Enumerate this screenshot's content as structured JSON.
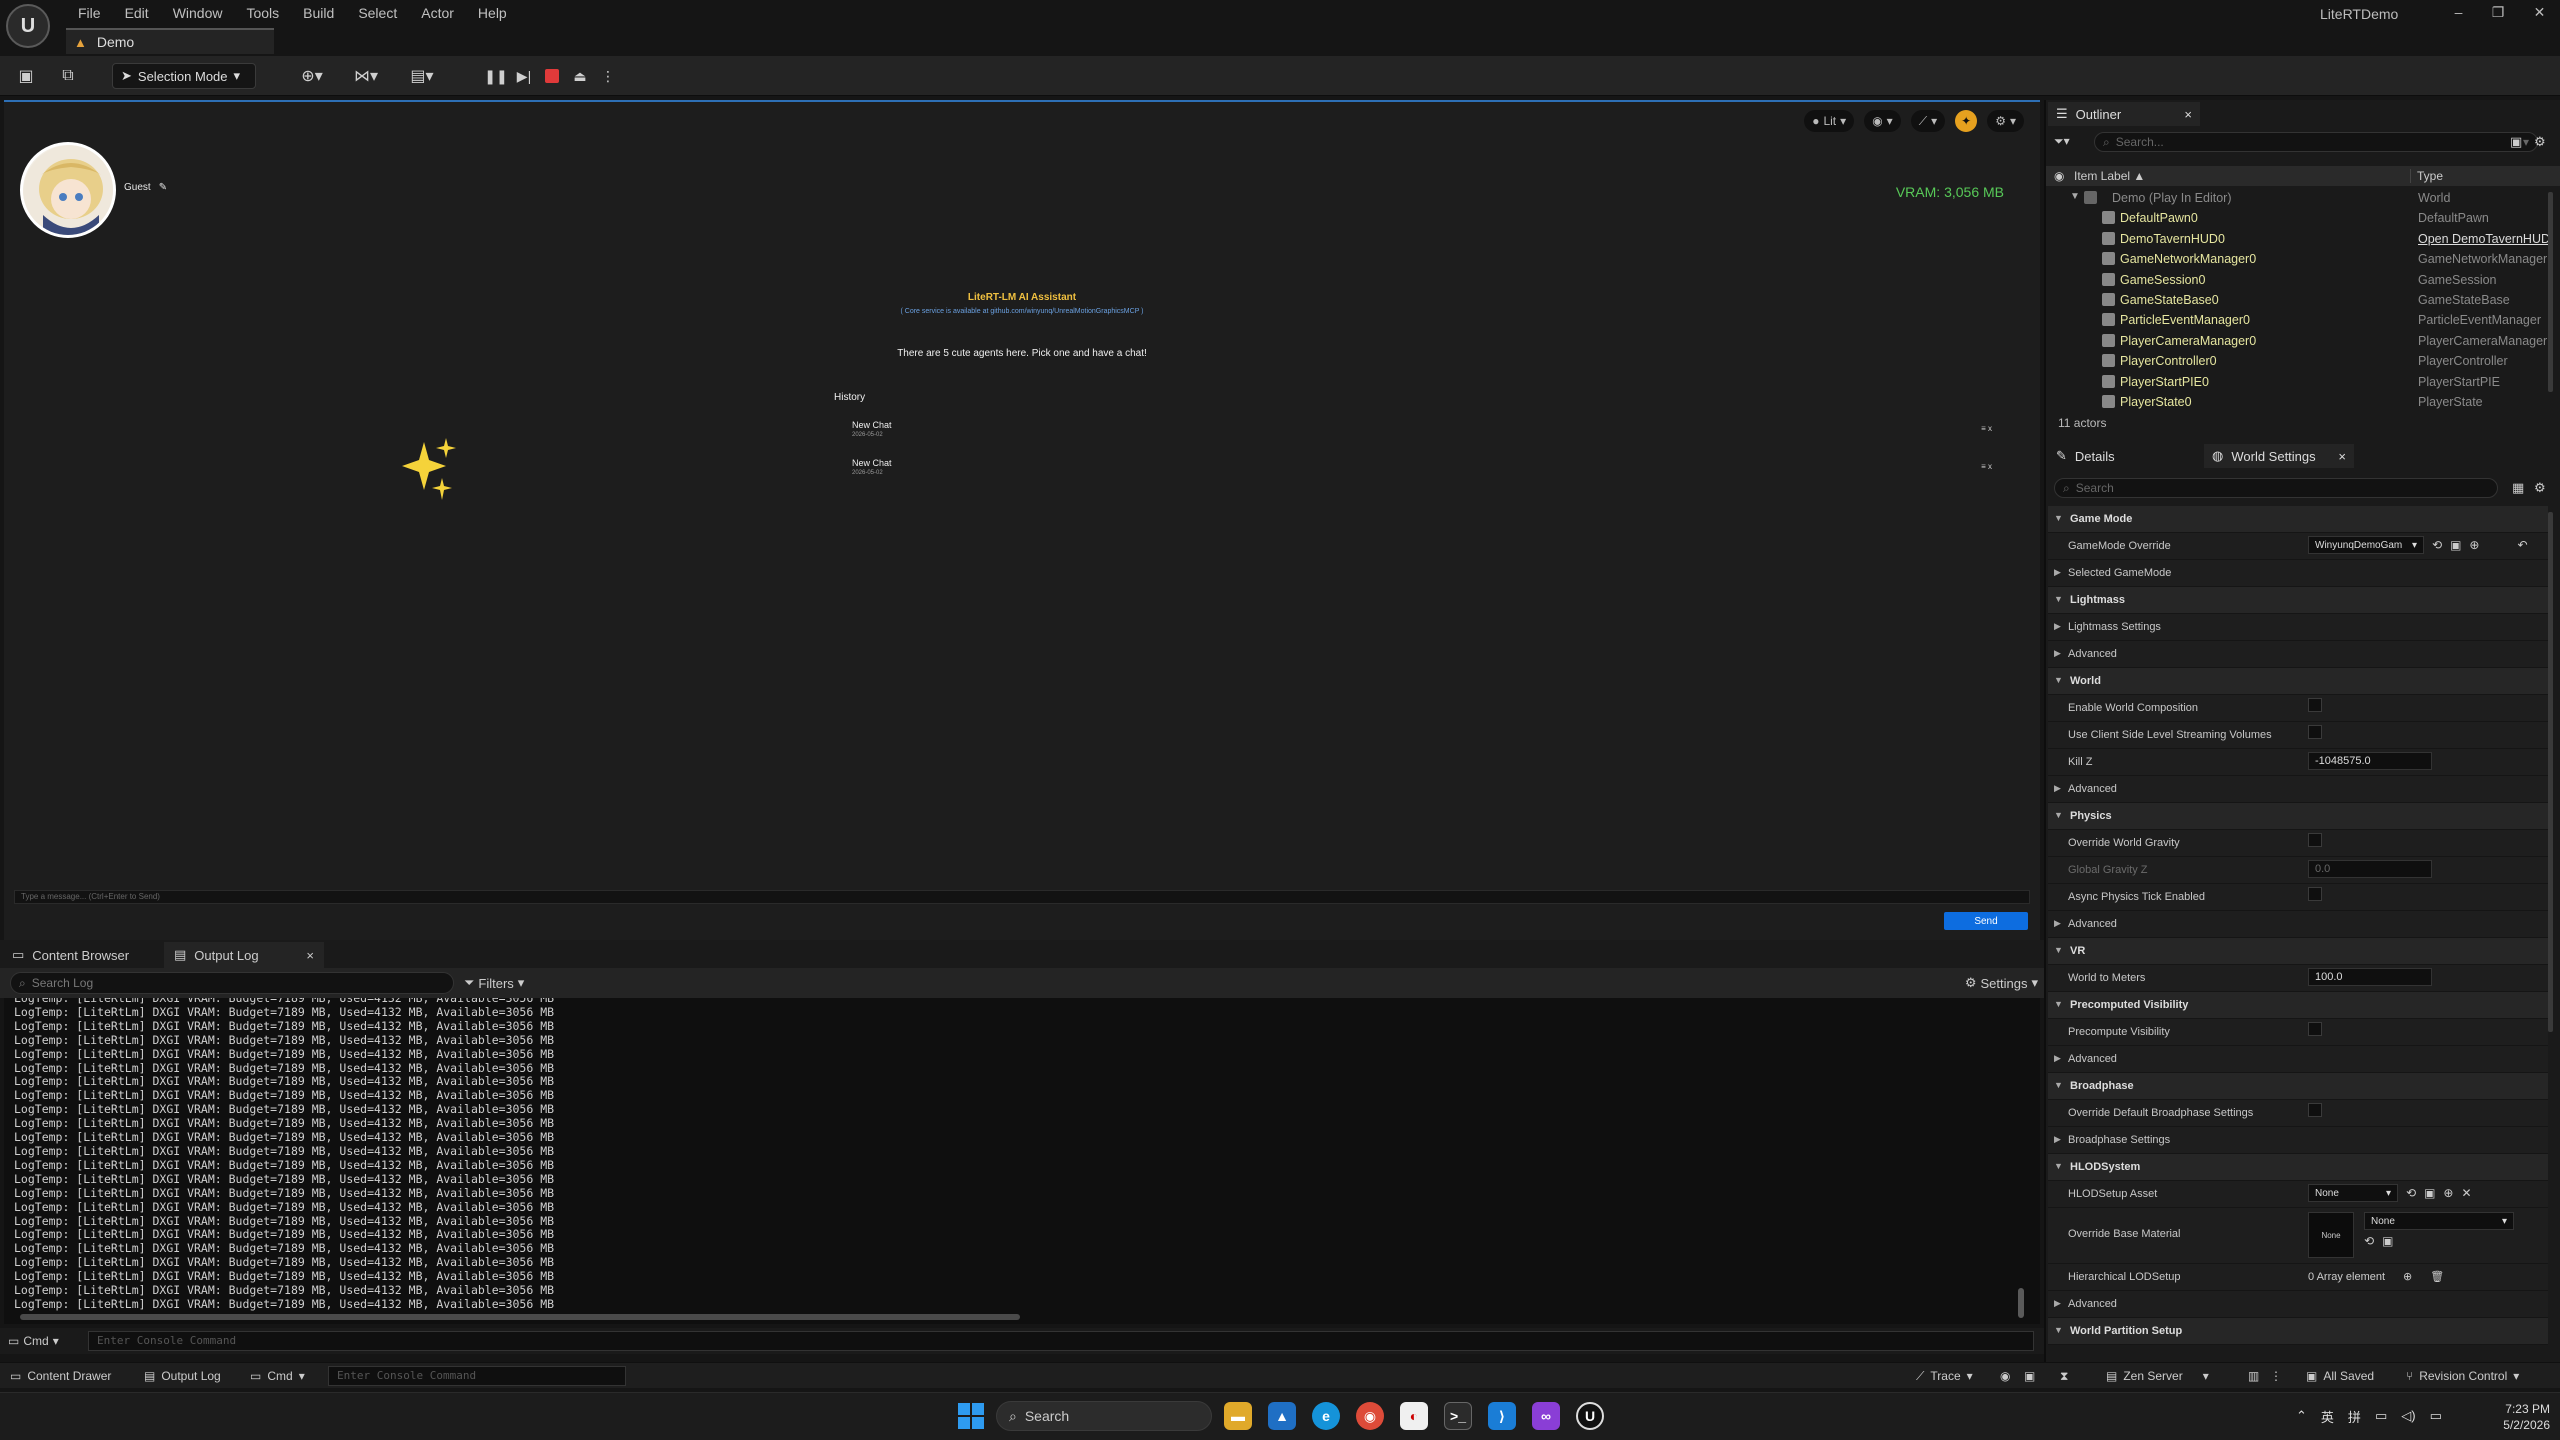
{
  "titlebar": {
    "menu": [
      "File",
      "Edit",
      "Window",
      "Tools",
      "Build",
      "Select",
      "Actor",
      "Help"
    ],
    "level_tab": "Demo",
    "app_title": "LiteRTDemo",
    "window_controls": [
      "–",
      "❐",
      "✕"
    ]
  },
  "toolbar": {
    "selection_mode": "Selection Mode"
  },
  "viewport": {
    "lit_label": "Lit",
    "guest_name": "Guest",
    "vram": "VRAM: 3,056 MB",
    "assistant_title": "LiteRT-LM AI Assistant",
    "assistant_sub": "( Core service is available at github.com/winyunq/UnrealMotionGraphicsMCP )",
    "agents_msg": "There are 5 cute agents here. Pick one and have a chat!",
    "history_title": "History",
    "chats": [
      {
        "name": "New Chat",
        "date": "2026-05-02",
        "actions": "≡  x"
      },
      {
        "name": "New Chat",
        "date": "2026-05-02",
        "actions": "≡  x"
      }
    ],
    "input_placeholder": "Type a message... (Ctrl+Enter to Send)",
    "send_label": "Send"
  },
  "bottom_tabs": {
    "content_browser": "Content Browser",
    "output_log": "Output Log",
    "close": "×"
  },
  "log": {
    "search_placeholder": "Search Log",
    "filters": "Filters",
    "settings": "Settings",
    "partial_line": "LogTemp: [LiteRtLm] DXGI VRAM: Budget=7189 MB, Used=4132 MB, Available=3056 MB",
    "line": "LogTemp: [LiteRtLm] DXGI VRAM: Budget=7189 MB, Used=4132 MB, Available=3056 MB",
    "line_count": 23,
    "cmd_label": "Cmd",
    "console_placeholder": "Enter Console Command"
  },
  "statusbar": {
    "content_drawer": "Content Drawer",
    "output_log": "Output Log",
    "cmd": "Cmd",
    "console_placeholder": "Enter Console Command",
    "trace": "Trace",
    "zen_server": "Zen Server",
    "all_saved": "All Saved",
    "revision_control": "Revision Control"
  },
  "outliner": {
    "tab": "Outliner",
    "search_placeholder": "Search...",
    "col_label": "Item Label ▲",
    "col_type": "Type",
    "rows": [
      {
        "label": "Demo (Play In Editor)",
        "type": "World",
        "root": true
      },
      {
        "label": "DefaultPawn0",
        "type": "DefaultPawn"
      },
      {
        "label": "DemoTavernHUD0",
        "type": "Open DemoTavernHUD",
        "link": true
      },
      {
        "label": "GameNetworkManager0",
        "type": "GameNetworkManager"
      },
      {
        "label": "GameSession0",
        "type": "GameSession"
      },
      {
        "label": "GameStateBase0",
        "type": "GameStateBase"
      },
      {
        "label": "ParticleEventManager0",
        "type": "ParticleEventManager"
      },
      {
        "label": "PlayerCameraManager0",
        "type": "PlayerCameraManager"
      },
      {
        "label": "PlayerController0",
        "type": "PlayerController"
      },
      {
        "label": "PlayerStartPIE0",
        "type": "PlayerStartPIE"
      },
      {
        "label": "PlayerState0",
        "type": "PlayerState"
      }
    ],
    "actor_count": "11 actors"
  },
  "details": {
    "tab_details": "Details",
    "tab_world_settings": "World Settings",
    "search_placeholder": "Search",
    "rows": [
      {
        "kind": "cat",
        "label": "Game Mode"
      },
      {
        "kind": "prop",
        "label": "GameMode Override",
        "value_type": "dropdown",
        "value": "WinyunqDemoGam"
      },
      {
        "kind": "sub",
        "label": "Selected GameMode"
      },
      {
        "kind": "cat",
        "label": "Lightmass"
      },
      {
        "kind": "sub",
        "label": "Lightmass Settings"
      },
      {
        "kind": "sub",
        "label": "Advanced"
      },
      {
        "kind": "cat",
        "label": "World"
      },
      {
        "kind": "prop",
        "label": "Enable World Composition",
        "value_type": "check"
      },
      {
        "kind": "prop",
        "label": "Use Client Side Level Streaming Volumes",
        "value_type": "check"
      },
      {
        "kind": "prop",
        "label": "Kill Z",
        "value_type": "number",
        "value": "-1048575.0"
      },
      {
        "kind": "sub",
        "label": "Advanced"
      },
      {
        "kind": "cat",
        "label": "Physics"
      },
      {
        "kind": "prop",
        "label": "Override World Gravity",
        "value_type": "check"
      },
      {
        "kind": "prop",
        "label": "Global Gravity Z",
        "value_type": "number",
        "value": "0.0",
        "disabled": true
      },
      {
        "kind": "prop",
        "label": "Async Physics Tick Enabled",
        "value_type": "check"
      },
      {
        "kind": "sub",
        "label": "Advanced"
      },
      {
        "kind": "cat",
        "label": "VR"
      },
      {
        "kind": "prop",
        "label": "World to Meters",
        "value_type": "number",
        "value": "100.0"
      },
      {
        "kind": "cat",
        "label": "Precomputed Visibility"
      },
      {
        "kind": "prop",
        "label": "Precompute Visibility",
        "value_type": "check"
      },
      {
        "kind": "sub",
        "label": "Advanced"
      },
      {
        "kind": "cat",
        "label": "Broadphase"
      },
      {
        "kind": "prop",
        "label": "Override Default Broadphase Settings",
        "value_type": "check"
      },
      {
        "kind": "sub",
        "label": "Broadphase Settings"
      },
      {
        "kind": "cat",
        "label": "HLODSystem"
      },
      {
        "kind": "prop",
        "label": "HLODSetup Asset",
        "value_type": "dropdown",
        "value": "None"
      },
      {
        "kind": "prop",
        "label": "Override Base Material",
        "value_type": "material",
        "value": "None",
        "thumb": "None",
        "tall": true
      },
      {
        "kind": "prop",
        "label": "Hierarchical LODSetup",
        "value_type": "text",
        "value": "0 Array element"
      },
      {
        "kind": "sub",
        "label": "Advanced"
      },
      {
        "kind": "cat",
        "label": "World Partition Setup"
      }
    ]
  },
  "taskbar": {
    "search": "Search",
    "clock_time": "7:23 PM",
    "clock_date": "5/2/2026",
    "ime_1": "英",
    "ime_2": "拼"
  },
  "colors": {
    "accent_blue": "#0d6de0",
    "vram_green": "#58c958",
    "title_gold": "#f0c040"
  }
}
